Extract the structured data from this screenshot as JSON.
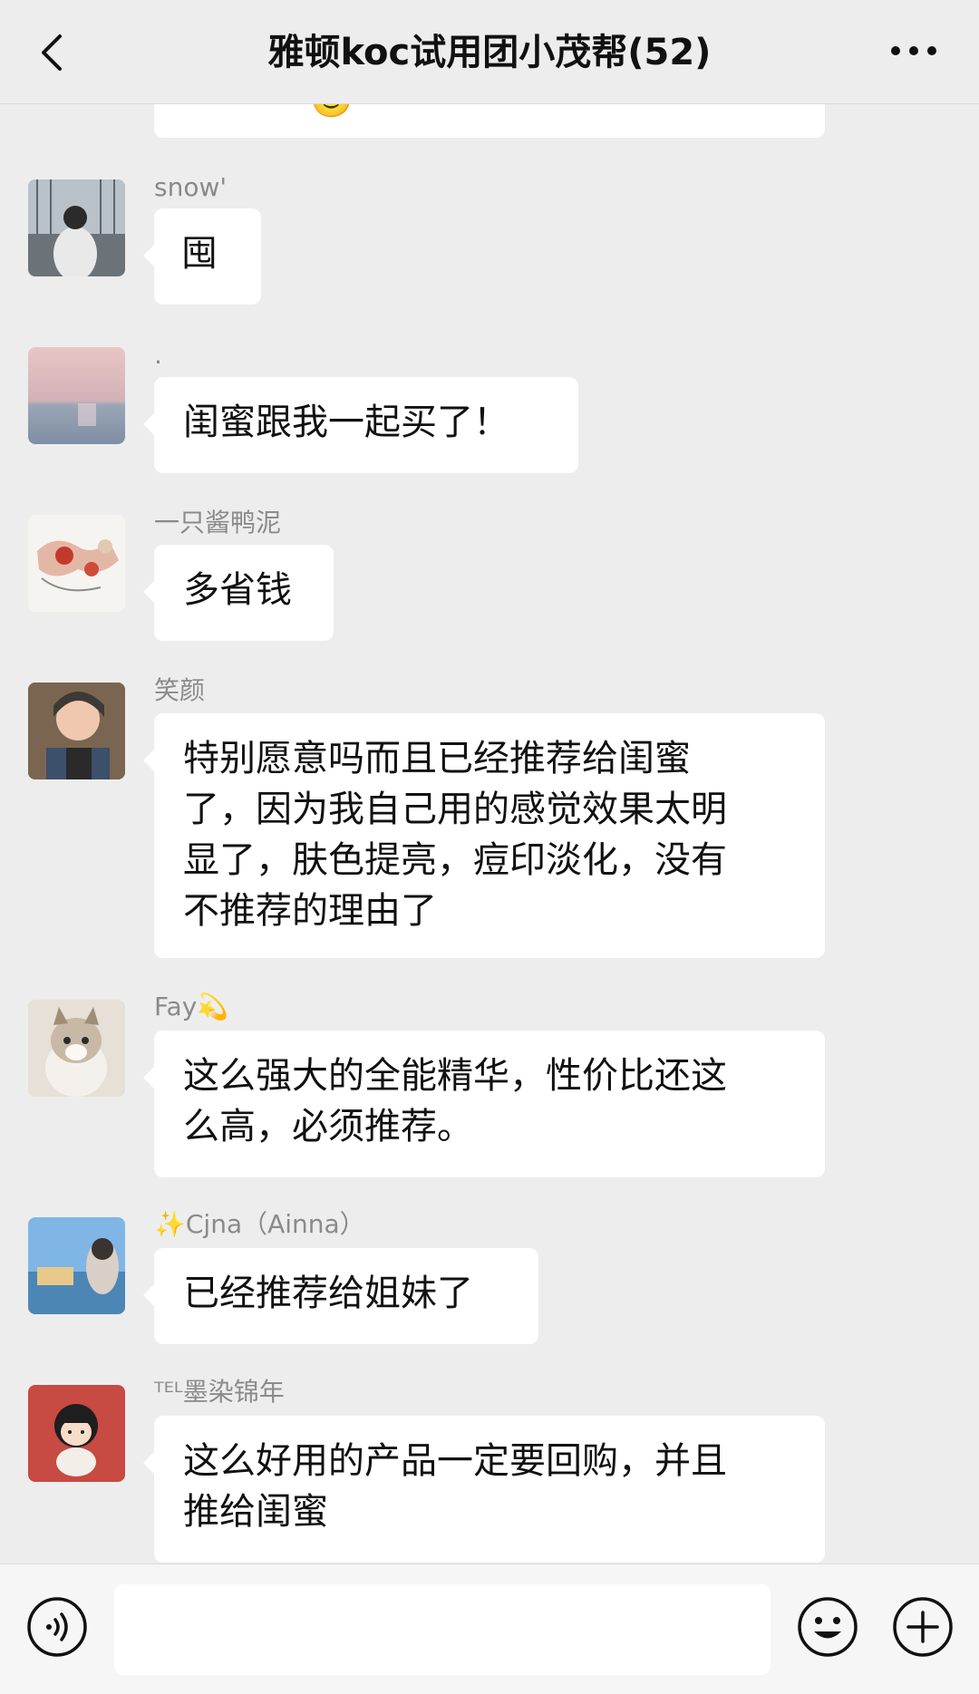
{
  "header": {
    "title": "雅顿koc试用团小茂帮(52)"
  },
  "messages": [
    {
      "sender": "snow'",
      "text": "囤"
    },
    {
      "sender": ".",
      "text": "闺蜜跟我一起买了！"
    },
    {
      "sender": "一只酱鸭泥",
      "text": "多省钱"
    },
    {
      "sender": "笑颜",
      "lines": [
        "特别愿意吗而且已经推荐给闺蜜",
        "了，因为我自己用的感觉效果太明",
        "显了，肤色提亮，痘印淡化，没有",
        "不推荐的理由了"
      ]
    },
    {
      "sender": "Fay💫",
      "lines": [
        "这么强大的全能精华，性价比还这",
        "么高，必须推荐。"
      ]
    },
    {
      "sender": "✨Cjna（Ainna）",
      "text": "已经推荐给姐妹了"
    },
    {
      "sender": "ᵀᴱᴸ墨染锦年",
      "lines": [
        "这么好用的产品一定要回购，并且",
        "推给闺蜜"
      ]
    }
  ],
  "partial_top_bubble": {
    "visible_fragment": "🙂"
  },
  "icons": {
    "back": "back-chevron-icon",
    "more": "more-dots-icon",
    "voice": "voice-input-icon",
    "emoji": "emoji-icon",
    "plus": "plus-icon"
  },
  "colors": {
    "background": "#ededed",
    "bubble": "#ffffff",
    "sender_text": "#8a8a8a"
  }
}
